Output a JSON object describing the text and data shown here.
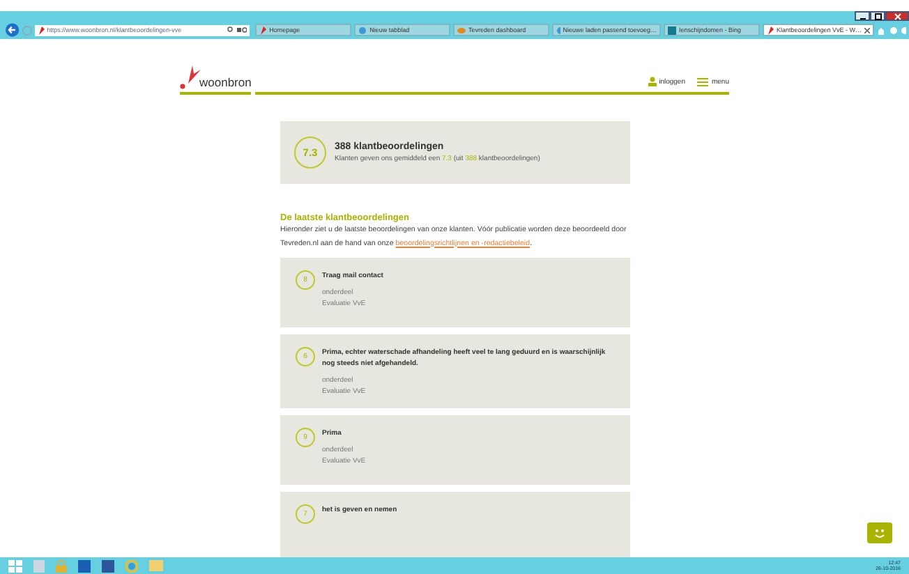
{
  "browser": {
    "address": "https://www.woonbron.nl/klantbeoordelingen-vve",
    "tabs": [
      {
        "label": "Homepage",
        "selected": false,
        "kind": "logo"
      },
      {
        "label": "Nieuw tabblad",
        "selected": false,
        "kind": "ie"
      },
      {
        "label": "Tevreden dashboard",
        "selected": false,
        "kind": "eye"
      },
      {
        "label": "Nieuwe laden passend toevoeg…",
        "selected": false,
        "kind": "ie"
      },
      {
        "label": "Ienschijndomen - Bing",
        "selected": false,
        "kind": "bing"
      },
      {
        "label": "Klantbeoordelingen VvE - W…",
        "selected": true,
        "kind": "logo"
      }
    ]
  },
  "header": {
    "logo": "woonbron",
    "login": "inloggen",
    "menu": "menu"
  },
  "summary": {
    "score": "7.3",
    "title": "388 klantbeoordelingen",
    "text": "Klanten geven ons gemiddeld een **7.3** (uit **388** klantbeoordelingen)"
  },
  "intro": {
    "heading": "De laatste klantbeoordelingen",
    "text": "Hieronder ziet u de laatste beoordelingen van onze klanten. Vóór publicatie worden deze beoordeeld door Tevreden.nl aan de hand van onze",
    "link": "beoordelingsrichtlijnen en -redactiebeleid",
    "after": "."
  },
  "reviews": [
    {
      "score": "8",
      "title": "Traag mail contact",
      "label": "onderdeel",
      "value": "Evaluatie VvE"
    },
    {
      "score": "6",
      "title": "Prima, echter waterschade afhandeling heeft veel te lang geduurd en is waarschijnlijk nog steeds niet afgehandeld.",
      "label": "onderdeel",
      "value": "Evaluatie VvE"
    },
    {
      "score": "9",
      "title": "Prima",
      "label": "onderdeel",
      "value": "Evaluatie VvE"
    },
    {
      "score": "7",
      "title": "het is geven en nemen"
    }
  ],
  "taskbar": {
    "time": "12:47",
    "date": "26-10-2016"
  }
}
